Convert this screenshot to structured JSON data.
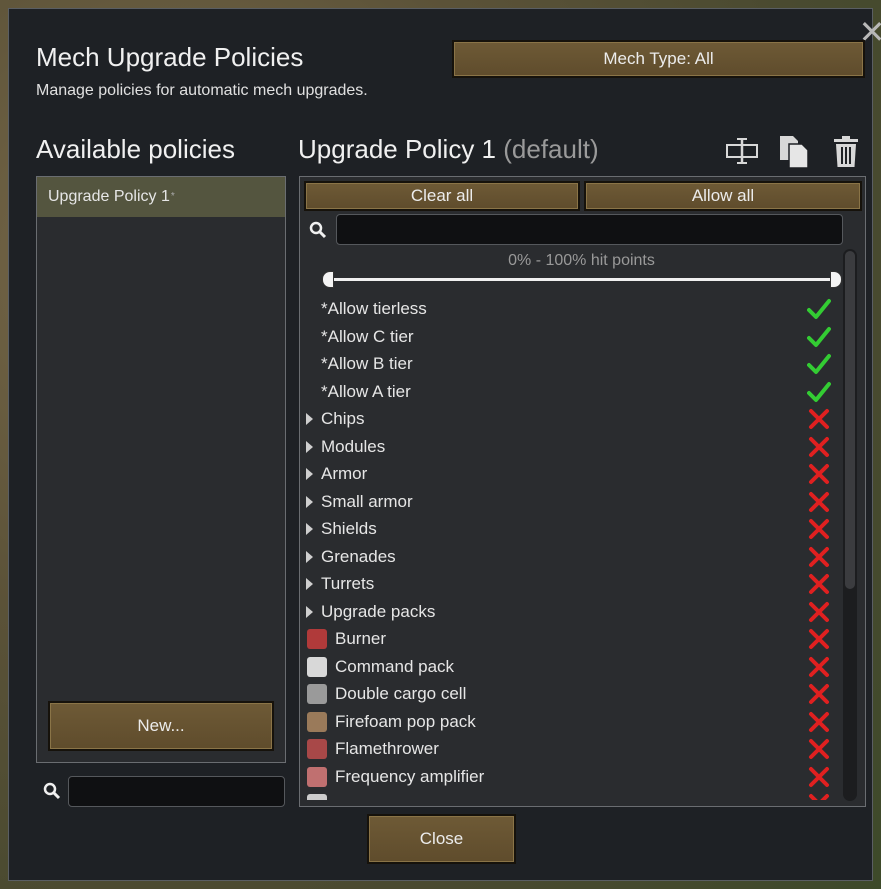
{
  "dialog": {
    "title": "Mech Upgrade Policies",
    "subtitle": "Manage policies for automatic mech upgrades.",
    "close_x": "✕",
    "mech_type_button": "Mech Type: All",
    "close_button": "Close"
  },
  "left": {
    "title": "Available policies",
    "policies": [
      {
        "name": "Upgrade Policy 1",
        "marker": "*"
      }
    ],
    "new_button": "New..."
  },
  "right": {
    "policy_name": "Upgrade Policy 1",
    "policy_suffix": "(default)",
    "clear_all": "Clear all",
    "allow_all": "Allow all",
    "hit_points_label": "0% - 100% hit points",
    "hit_points_range": [
      0,
      100
    ],
    "scroll_fraction_visible": 0.62
  },
  "icons": {
    "rename": "rename-icon",
    "copy": "copy-icon",
    "delete": "trash-icon",
    "search": "search-icon",
    "allowed": "check-icon",
    "disallowed": "cross-icon"
  },
  "colors": {
    "allowed": "#33cc33",
    "disallowed": "#e02020",
    "button": "#6e5a36",
    "selected": "#54553f"
  },
  "rows": [
    {
      "label": "*Allow tierless",
      "kind": "plain",
      "allowed": true
    },
    {
      "label": "*Allow C tier",
      "kind": "plain",
      "allowed": true
    },
    {
      "label": "*Allow B tier",
      "kind": "plain",
      "allowed": true
    },
    {
      "label": "*Allow A tier",
      "kind": "plain",
      "allowed": true
    },
    {
      "label": "Chips",
      "kind": "category",
      "allowed": false
    },
    {
      "label": "Modules",
      "kind": "category",
      "allowed": false
    },
    {
      "label": "Armor",
      "kind": "category",
      "allowed": false
    },
    {
      "label": "Small armor",
      "kind": "category",
      "allowed": false
    },
    {
      "label": "Shields",
      "kind": "category",
      "allowed": false
    },
    {
      "label": "Grenades",
      "kind": "category",
      "allowed": false
    },
    {
      "label": "Turrets",
      "kind": "category",
      "allowed": false
    },
    {
      "label": "Upgrade packs",
      "kind": "category",
      "allowed": false
    },
    {
      "label": "Burner",
      "kind": "item",
      "icon_color": "#b03a3a",
      "allowed": false
    },
    {
      "label": "Command pack",
      "kind": "item",
      "icon_color": "#d8d8d8",
      "allowed": false
    },
    {
      "label": "Double cargo cell",
      "kind": "item",
      "icon_color": "#9a9a9a",
      "allowed": false
    },
    {
      "label": "Firefoam pop pack",
      "kind": "item",
      "icon_color": "#9a7a5a",
      "allowed": false
    },
    {
      "label": "Flamethrower",
      "kind": "item",
      "icon_color": "#a84848",
      "allowed": false
    },
    {
      "label": "Frequency amplifier",
      "kind": "item",
      "icon_color": "#c07070",
      "allowed": false
    },
    {
      "label": "",
      "kind": "item",
      "icon_color": "#cccccc",
      "allowed": false
    }
  ]
}
